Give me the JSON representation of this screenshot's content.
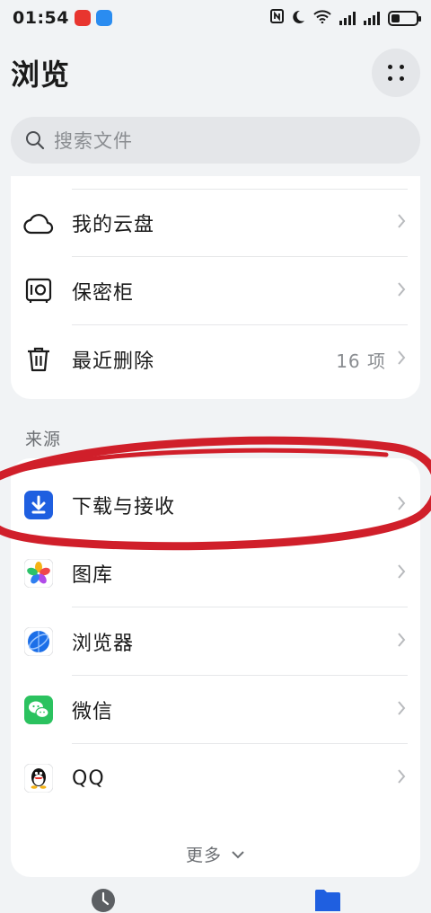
{
  "status_bar": {
    "time": "01:54",
    "app_icons": [
      "taobao-icon",
      "message-icon"
    ],
    "icons": [
      "nfc-icon",
      "moon-icon",
      "wifi-icon",
      "signal-icon",
      "signal-icon",
      "battery-icon"
    ],
    "battery_level": 0.35
  },
  "header": {
    "title": "浏览",
    "more_icon": "grid-dots-icon"
  },
  "search": {
    "placeholder": "搜索文件"
  },
  "locations": [
    {
      "label": "我的云盘",
      "icon": "cloud-icon"
    },
    {
      "label": "保密柜",
      "icon": "safe-icon"
    },
    {
      "label": "最近删除",
      "icon": "trash-icon",
      "count": "16 项"
    }
  ],
  "sources": {
    "section_label": "来源",
    "items": [
      {
        "label": "下载与接收",
        "icon": "download-icon"
      },
      {
        "label": "图库",
        "icon": "gallery-icon"
      },
      {
        "label": "浏览器",
        "icon": "browser-icon"
      },
      {
        "label": "微信",
        "icon": "wechat-icon"
      },
      {
        "label": "QQ",
        "icon": "qq-icon"
      }
    ],
    "more_label": "更多"
  },
  "bottom_nav": {
    "items": [
      {
        "icon": "clock-icon"
      },
      {
        "icon": "folder-icon"
      }
    ]
  },
  "colors": {
    "accent": "#1f5fe0",
    "annotation": "#d01f2a",
    "wechat": "#2bc25f"
  }
}
